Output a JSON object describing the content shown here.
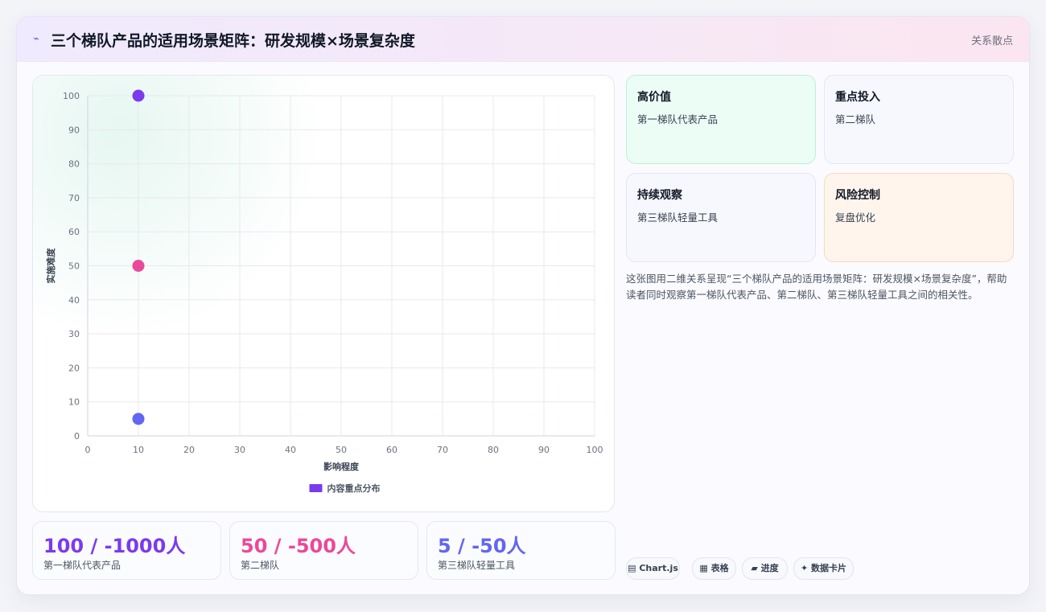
{
  "header": {
    "icon": "lightning-icon",
    "title": "三个梯队产品的适用场景矩阵：研发规模×场景复杂度",
    "tag": "关系散点"
  },
  "chart_data": {
    "type": "scatter",
    "xlabel": "影响程度",
    "ylabel": "实施难度",
    "xlim": [
      0,
      100
    ],
    "ylim": [
      0,
      100
    ],
    "xticks": [
      0,
      10,
      20,
      30,
      40,
      50,
      60,
      70,
      80,
      90,
      100
    ],
    "yticks": [
      0,
      10,
      20,
      30,
      40,
      50,
      60,
      70,
      80,
      90,
      100
    ],
    "grid": true,
    "legend_position": "bottom",
    "series": [
      {
        "name": "内容重点分布",
        "color": "#7c3aed",
        "points": [
          {
            "x": 10,
            "y": 100,
            "color": "#7c3aed"
          },
          {
            "x": 10,
            "y": 50,
            "color": "#ec4899"
          },
          {
            "x": 10,
            "y": 5,
            "color": "#6366f1"
          }
        ]
      }
    ]
  },
  "stats": [
    {
      "value": "100 / -1000人",
      "label": "第一梯队代表产品",
      "color": "#7c3aed"
    },
    {
      "value": "50 / -500人",
      "label": "第二梯队",
      "color": "#ec4899"
    },
    {
      "value": "5 / -50人",
      "label": "第三梯队轻量工具",
      "color": "#6366f1"
    }
  ],
  "quadrants": [
    {
      "title": "高价值",
      "sub": "第一梯队代表产品",
      "bg": "#ecfdf5",
      "border": "#bbf0d6"
    },
    {
      "title": "重点投入",
      "sub": "第二梯队",
      "bg": "#f7f8fd",
      "border": "#e3e6f2"
    },
    {
      "title": "持续观察",
      "sub": "第三梯队轻量工具",
      "bg": "#f7f8fd",
      "border": "#e3e6f2"
    },
    {
      "title": "风险控制",
      "sub": "复盘优化",
      "bg": "#fff5ec",
      "border": "#f6d9bd"
    }
  ],
  "description": "这张图用二维关系呈现“三个梯队产品的适用场景矩阵：研发规模×场景复杂度”，帮助读者同时观察第一梯队代表产品、第二梯队、第三梯队轻量工具之间的相关性。",
  "chips": [
    {
      "icon": "▤",
      "label": "Chart.js"
    },
    {
      "icon": "▦",
      "label": "表格"
    },
    {
      "icon": "▰",
      "label": "进度"
    },
    {
      "icon": "✦",
      "label": "数据卡片"
    }
  ]
}
